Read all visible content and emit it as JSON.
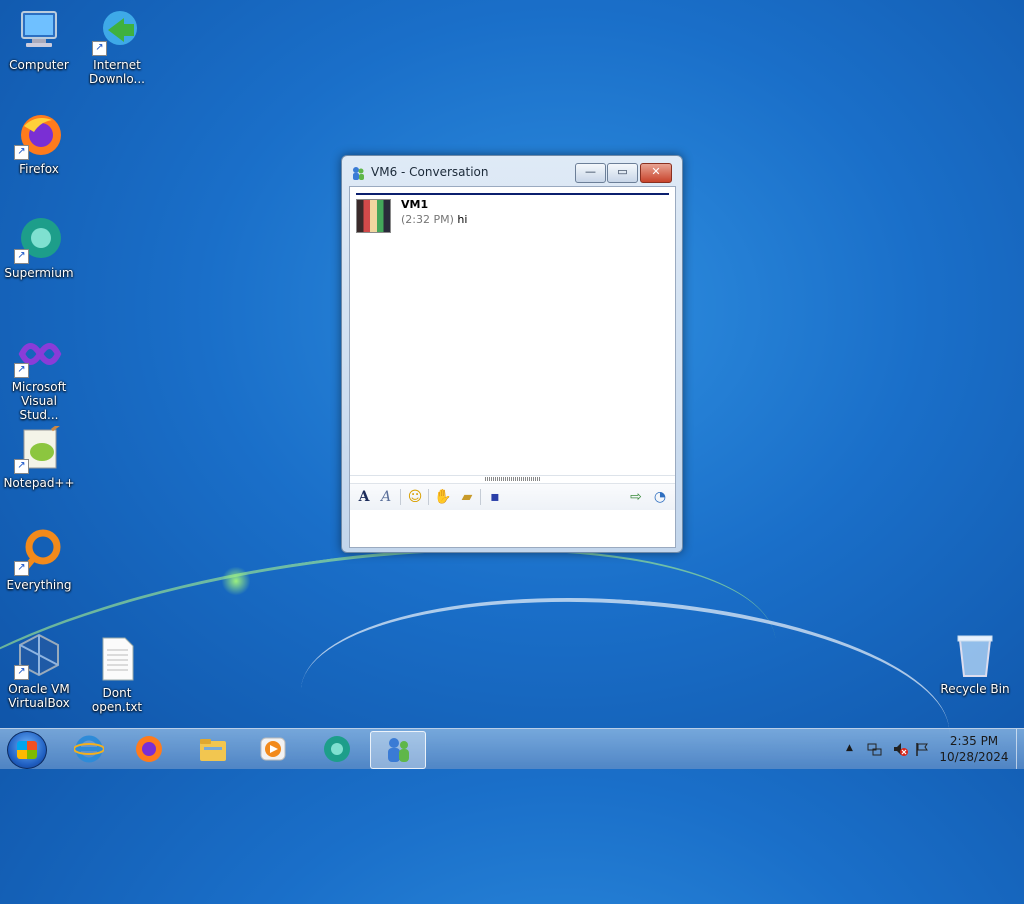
{
  "desktop": {
    "icons": [
      {
        "label": "Computer"
      },
      {
        "label": "Internet Downlo..."
      },
      {
        "label": "Firefox"
      },
      {
        "label": "Supermium"
      },
      {
        "label": "Microsoft Visual Stud..."
      },
      {
        "label": "Notepad++"
      },
      {
        "label": "Everything"
      },
      {
        "label": "Oracle VM VirtualBox"
      },
      {
        "label": "Dont open.txt"
      },
      {
        "label": "Recycle Bin"
      }
    ]
  },
  "window": {
    "title": "VM6 - Conversation",
    "buttons": {
      "minimize": "—",
      "maximize": "▭",
      "close": "✕"
    },
    "message": {
      "sender": "VM1",
      "time": "(2:32 PM)",
      "text": "hi"
    },
    "toolbar": [
      "font",
      "font-style",
      "emoticon",
      "nudge",
      "file-transfer",
      "save",
      "invite",
      "history"
    ]
  },
  "taskbar": {
    "clock": {
      "time": "2:35 PM",
      "date": "10/28/2024"
    },
    "tray": {
      "chevron": "▲"
    },
    "colors": {
      "accent": "#1f5ec0"
    }
  }
}
